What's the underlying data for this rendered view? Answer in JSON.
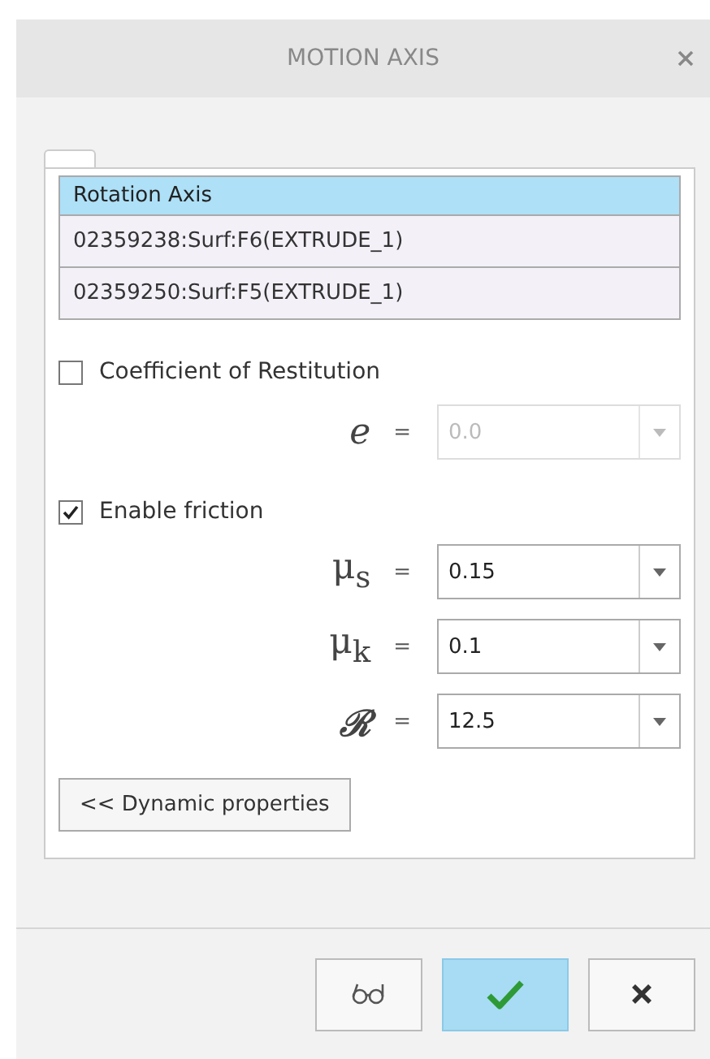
{
  "window": {
    "title": "MOTION AXIS"
  },
  "collector": {
    "header": "Rotation Axis",
    "items": [
      {
        "label": "02359238:Surf:F6(EXTRUDE_1)"
      },
      {
        "label": "02359250:Surf:F5(EXTRUDE_1)"
      }
    ]
  },
  "sections": [
    {
      "label": "Coefficient of Restitution",
      "checked": false,
      "params": [
        {
          "symbol": "e",
          "kind": "italic",
          "value": "0.0",
          "disabled": true
        }
      ]
    },
    {
      "label": "Enable friction",
      "checked": true,
      "params": [
        {
          "symbol": "μ$_{s}$",
          "kind": "plain",
          "value": "0.15",
          "disabled": false
        },
        {
          "symbol": "μ$_{k}$",
          "kind": "plain",
          "value": "0.1",
          "disabled": false
        },
        {
          "symbol": "ℛ",
          "kind": "script",
          "value": "12.5",
          "disabled": false
        }
      ]
    }
  ],
  "equals": "=",
  "toggle_button": "<< Dynamic properties"
}
